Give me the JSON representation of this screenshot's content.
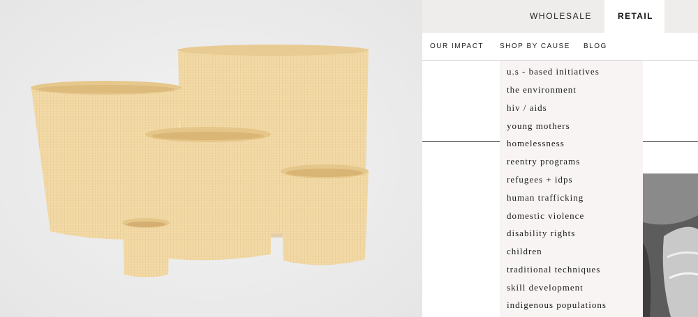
{
  "header": {
    "wholesale_label": "WHOLESALE",
    "retail_label": "RETAIL"
  },
  "subnav": {
    "items": [
      {
        "label": "OUR IMPACT"
      },
      {
        "label": "SHOP BY CAUSE"
      },
      {
        "label": "BLOG"
      }
    ]
  },
  "dropdown": {
    "items": [
      {
        "label": "u.s - based initiatives"
      },
      {
        "label": "the environment"
      },
      {
        "label": "hiv / aids"
      },
      {
        "label": "young mothers"
      },
      {
        "label": "homelessness"
      },
      {
        "label": "reentry programs"
      },
      {
        "label": "refugees + idps"
      },
      {
        "label": "human trafficking"
      },
      {
        "label": "domestic violence"
      },
      {
        "label": "disability rights"
      },
      {
        "label": "children"
      },
      {
        "label": "traditional techniques"
      },
      {
        "label": "skill development"
      },
      {
        "label": "indigenous populations"
      }
    ]
  },
  "colors": {
    "topbar_bg": "#efedec",
    "dropdown_bg": "#f7f4f3",
    "basket": "#f2d9a6"
  }
}
